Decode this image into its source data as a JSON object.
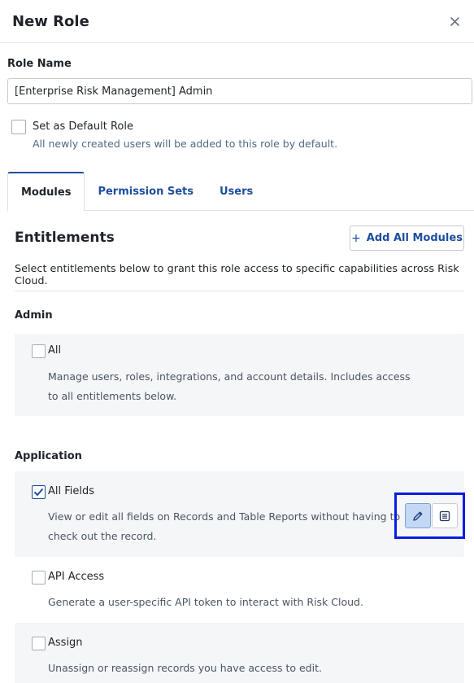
{
  "dialog": {
    "title": "New Role",
    "close_icon": "close-icon"
  },
  "role_name": {
    "label": "Role Name",
    "value": "[Enterprise Risk Management] Admin"
  },
  "default_role": {
    "label": "Set as Default Role",
    "help": "All newly created users will be added to this role by default.",
    "checked": false
  },
  "tabs": [
    {
      "label": "Modules",
      "active": true
    },
    {
      "label": "Permission Sets",
      "active": false
    },
    {
      "label": "Users",
      "active": false
    }
  ],
  "entitlements": {
    "title": "Entitlements",
    "add_all_label": "Add All Modules",
    "description": "Select entitlements below to grant this role access to specific capabilities across Risk Cloud."
  },
  "sections": {
    "admin": {
      "label": "Admin",
      "items": [
        {
          "name": "All",
          "desc_line1": "Manage users, roles, integrations, and account details. Includes access",
          "desc_line2": "to all entitlements below.",
          "checked": false
        }
      ]
    },
    "application": {
      "label": "Application",
      "items": [
        {
          "name": "All Fields",
          "desc_line1": "View or edit all fields on Records and Table Reports without having to",
          "desc_line2": "check out the record.",
          "checked": true,
          "permission": "edit"
        },
        {
          "name": "API Access",
          "desc_line1": "Generate a user-specific API token to interact with Risk Cloud.",
          "checked": false
        },
        {
          "name": "Assign",
          "desc_line1": "Unassign or reassign records you have access to edit.",
          "checked": false
        }
      ]
    }
  },
  "colors": {
    "accent": "#1d4e9e",
    "highlight_box": "#0a1ee0",
    "edit_selected": "#c4d7f5"
  }
}
